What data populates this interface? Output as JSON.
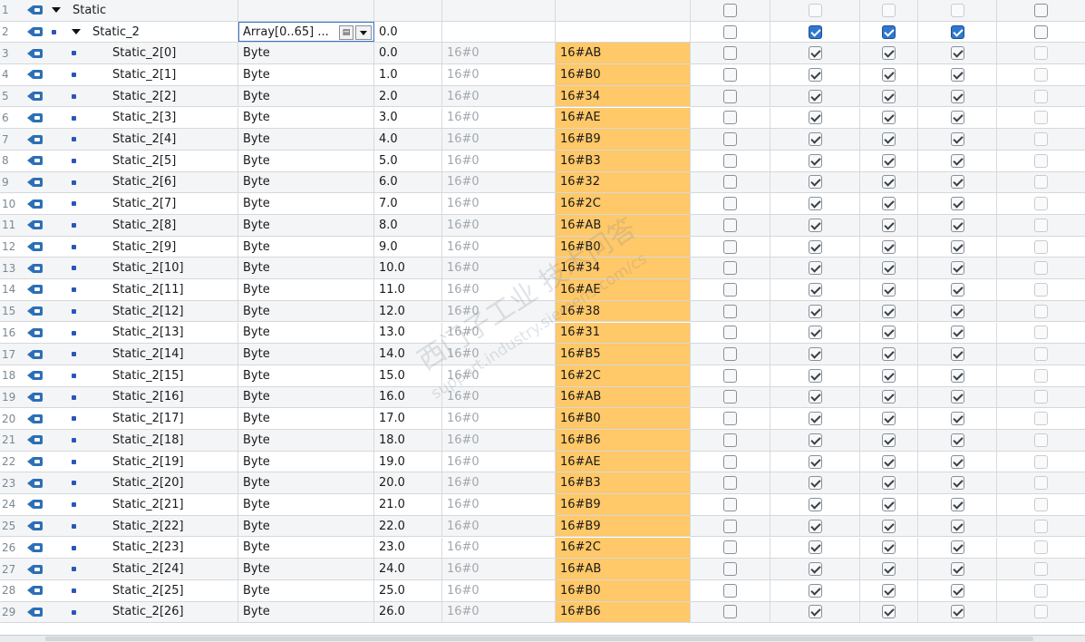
{
  "rows": [
    {
      "num": "1",
      "name": "Static",
      "level": 0,
      "expand": true,
      "dot": false,
      "type": "",
      "offset": "",
      "default": "",
      "monitor": "",
      "hl": false,
      "checks": [
        0,
        0,
        0,
        0,
        0
      ],
      "blue": false,
      "header": true
    },
    {
      "num": "2",
      "name": "Static_2",
      "level": 1,
      "expand": true,
      "dot": true,
      "type": "Array[0..65] ...",
      "offset": "0.0",
      "default": "",
      "monitor": "",
      "hl": false,
      "checks": [
        0,
        1,
        1,
        1,
        0
      ],
      "blue": true,
      "edit": true
    },
    {
      "num": "3",
      "name": "Static_2[0]",
      "type": "Byte",
      "offset": "0.0",
      "default": "16#0",
      "monitor": "16#AB",
      "hl": true,
      "checks": [
        0,
        1,
        1,
        1,
        0
      ]
    },
    {
      "num": "4",
      "name": "Static_2[1]",
      "type": "Byte",
      "offset": "1.0",
      "default": "16#0",
      "monitor": "16#B0",
      "hl": true,
      "checks": [
        0,
        1,
        1,
        1,
        0
      ]
    },
    {
      "num": "5",
      "name": "Static_2[2]",
      "type": "Byte",
      "offset": "2.0",
      "default": "16#0",
      "monitor": "16#34",
      "hl": true,
      "checks": [
        0,
        1,
        1,
        1,
        0
      ]
    },
    {
      "num": "6",
      "name": "Static_2[3]",
      "type": "Byte",
      "offset": "3.0",
      "default": "16#0",
      "monitor": "16#AE",
      "hl": true,
      "checks": [
        0,
        1,
        1,
        1,
        0
      ]
    },
    {
      "num": "7",
      "name": "Static_2[4]",
      "type": "Byte",
      "offset": "4.0",
      "default": "16#0",
      "monitor": "16#B9",
      "hl": true,
      "checks": [
        0,
        1,
        1,
        1,
        0
      ]
    },
    {
      "num": "8",
      "name": "Static_2[5]",
      "type": "Byte",
      "offset": "5.0",
      "default": "16#0",
      "monitor": "16#B3",
      "hl": true,
      "checks": [
        0,
        1,
        1,
        1,
        0
      ]
    },
    {
      "num": "9",
      "name": "Static_2[6]",
      "type": "Byte",
      "offset": "6.0",
      "default": "16#0",
      "monitor": "16#32",
      "hl": true,
      "checks": [
        0,
        1,
        1,
        1,
        0
      ]
    },
    {
      "num": "10",
      "name": "Static_2[7]",
      "type": "Byte",
      "offset": "7.0",
      "default": "16#0",
      "monitor": "16#2C",
      "hl": true,
      "checks": [
        0,
        1,
        1,
        1,
        0
      ]
    },
    {
      "num": "11",
      "name": "Static_2[8]",
      "type": "Byte",
      "offset": "8.0",
      "default": "16#0",
      "monitor": "16#AB",
      "hl": true,
      "checks": [
        0,
        1,
        1,
        1,
        0
      ]
    },
    {
      "num": "12",
      "name": "Static_2[9]",
      "type": "Byte",
      "offset": "9.0",
      "default": "16#0",
      "monitor": "16#B0",
      "hl": true,
      "checks": [
        0,
        1,
        1,
        1,
        0
      ]
    },
    {
      "num": "13",
      "name": "Static_2[10]",
      "type": "Byte",
      "offset": "10.0",
      "default": "16#0",
      "monitor": "16#34",
      "hl": true,
      "checks": [
        0,
        1,
        1,
        1,
        0
      ]
    },
    {
      "num": "14",
      "name": "Static_2[11]",
      "type": "Byte",
      "offset": "11.0",
      "default": "16#0",
      "monitor": "16#AE",
      "hl": true,
      "checks": [
        0,
        1,
        1,
        1,
        0
      ]
    },
    {
      "num": "15",
      "name": "Static_2[12]",
      "type": "Byte",
      "offset": "12.0",
      "default": "16#0",
      "monitor": "16#38",
      "hl": true,
      "checks": [
        0,
        1,
        1,
        1,
        0
      ]
    },
    {
      "num": "16",
      "name": "Static_2[13]",
      "type": "Byte",
      "offset": "13.0",
      "default": "16#0",
      "monitor": "16#31",
      "hl": true,
      "checks": [
        0,
        1,
        1,
        1,
        0
      ]
    },
    {
      "num": "17",
      "name": "Static_2[14]",
      "type": "Byte",
      "offset": "14.0",
      "default": "16#0",
      "monitor": "16#B5",
      "hl": true,
      "checks": [
        0,
        1,
        1,
        1,
        0
      ]
    },
    {
      "num": "18",
      "name": "Static_2[15]",
      "type": "Byte",
      "offset": "15.0",
      "default": "16#0",
      "monitor": "16#2C",
      "hl": true,
      "checks": [
        0,
        1,
        1,
        1,
        0
      ]
    },
    {
      "num": "19",
      "name": "Static_2[16]",
      "type": "Byte",
      "offset": "16.0",
      "default": "16#0",
      "monitor": "16#AB",
      "hl": true,
      "checks": [
        0,
        1,
        1,
        1,
        0
      ]
    },
    {
      "num": "20",
      "name": "Static_2[17]",
      "type": "Byte",
      "offset": "17.0",
      "default": "16#0",
      "monitor": "16#B0",
      "hl": true,
      "checks": [
        0,
        1,
        1,
        1,
        0
      ]
    },
    {
      "num": "21",
      "name": "Static_2[18]",
      "type": "Byte",
      "offset": "18.0",
      "default": "16#0",
      "monitor": "16#B6",
      "hl": true,
      "checks": [
        0,
        1,
        1,
        1,
        0
      ]
    },
    {
      "num": "22",
      "name": "Static_2[19]",
      "type": "Byte",
      "offset": "19.0",
      "default": "16#0",
      "monitor": "16#AE",
      "hl": true,
      "checks": [
        0,
        1,
        1,
        1,
        0
      ]
    },
    {
      "num": "23",
      "name": "Static_2[20]",
      "type": "Byte",
      "offset": "20.0",
      "default": "16#0",
      "monitor": "16#B3",
      "hl": true,
      "checks": [
        0,
        1,
        1,
        1,
        0
      ]
    },
    {
      "num": "24",
      "name": "Static_2[21]",
      "type": "Byte",
      "offset": "21.0",
      "default": "16#0",
      "monitor": "16#B9",
      "hl": true,
      "checks": [
        0,
        1,
        1,
        1,
        0
      ]
    },
    {
      "num": "25",
      "name": "Static_2[22]",
      "type": "Byte",
      "offset": "22.0",
      "default": "16#0",
      "monitor": "16#B9",
      "hl": true,
      "checks": [
        0,
        1,
        1,
        1,
        0
      ]
    },
    {
      "num": "26",
      "name": "Static_2[23]",
      "type": "Byte",
      "offset": "23.0",
      "default": "16#0",
      "monitor": "16#2C",
      "hl": true,
      "checks": [
        0,
        1,
        1,
        1,
        0
      ]
    },
    {
      "num": "27",
      "name": "Static_2[24]",
      "type": "Byte",
      "offset": "24.0",
      "default": "16#0",
      "monitor": "16#AB",
      "hl": true,
      "checks": [
        0,
        1,
        1,
        1,
        0
      ]
    },
    {
      "num": "28",
      "name": "Static_2[25]",
      "type": "Byte",
      "offset": "25.0",
      "default": "16#0",
      "monitor": "16#B0",
      "hl": true,
      "checks": [
        0,
        1,
        1,
        1,
        0
      ]
    },
    {
      "num": "29",
      "name": "Static_2[26]",
      "type": "Byte",
      "offset": "26.0",
      "default": "16#0",
      "monitor": "16#B6",
      "hl": true,
      "checks": [
        0,
        1,
        1,
        1,
        0
      ]
    }
  ],
  "watermark": {
    "line1": "西门子工业 技术问答",
    "line2": "support.industry.siemens.com/cs"
  },
  "colors": {
    "monitor_highlight": "#ffc868",
    "accent_blue": "#2f78d0",
    "row_border": "#d5d8db"
  }
}
